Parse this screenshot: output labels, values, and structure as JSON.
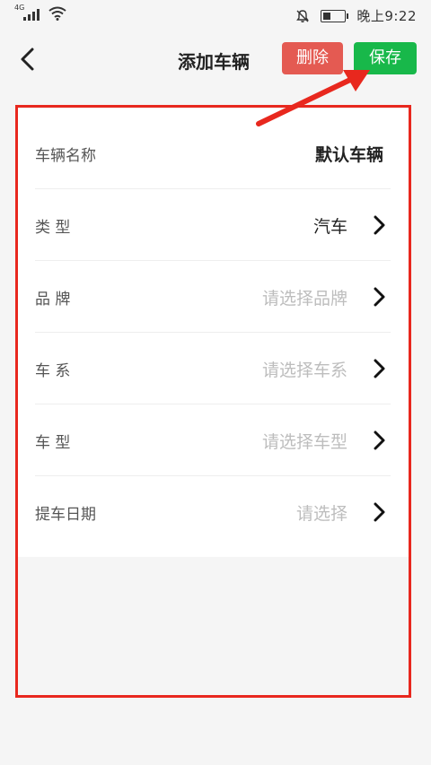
{
  "status_bar": {
    "network_type": "4G",
    "time": "晚上9:22",
    "icons": [
      "signal-icon",
      "wifi-icon",
      "mute-icon",
      "battery-icon"
    ]
  },
  "header": {
    "title": "添加车辆",
    "delete_label": "删除",
    "save_label": "保存",
    "back_icon": "back-chevron-icon"
  },
  "form": {
    "rows": [
      {
        "label": "车辆名称",
        "value": "默认车辆",
        "type": "text"
      },
      {
        "label": "类  型",
        "value": "汽车",
        "type": "select"
      },
      {
        "label": "品  牌",
        "placeholder": "请选择品牌",
        "type": "select"
      },
      {
        "label": "车  系",
        "placeholder": "请选择车系",
        "type": "select"
      },
      {
        "label": "车  型",
        "placeholder": "请选择车型",
        "type": "select"
      },
      {
        "label": "提车日期",
        "placeholder": "请选择",
        "type": "select"
      }
    ]
  },
  "colors": {
    "save_button": "#18b84a",
    "delete_button": "#e45a52",
    "annotation": "#e8281e",
    "background": "#f5f5f5",
    "card": "#ffffff",
    "placeholder": "#bdbdbd"
  }
}
